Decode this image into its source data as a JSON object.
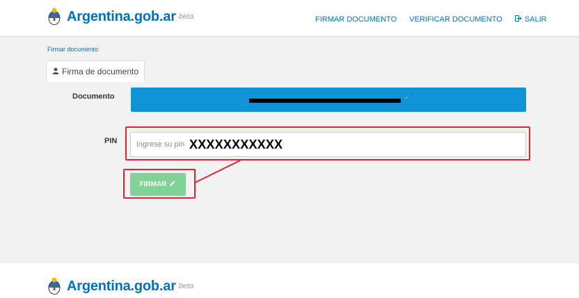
{
  "header": {
    "brand_name": "Argentina.gob.ar",
    "brand_tag": "beta",
    "nav": {
      "firmar": "FIRMAR DOCUMENTO",
      "verificar": "VERIFICAR DOCUMENTO",
      "salir": "SALIR"
    }
  },
  "main": {
    "breadcrumb": "Firmar documento",
    "tab_label": "Firma de documento",
    "documento_label": "Documento",
    "pin_label": "PIN",
    "pin_placeholder": "Ingrese su pin",
    "pin_value": "XXXXXXXXXXX",
    "firmar_button": "FIRMAR"
  },
  "footer": {
    "brand_name": "Argentina.gob.ar",
    "brand_tag": "beta"
  },
  "colors": {
    "brand_blue": "#0072bb",
    "doc_bar": "#0f94d8",
    "button_green": "#82d196",
    "highlight_red": "#e2232f"
  },
  "icons": [
    "argentina-emblem-icon",
    "exit-icon",
    "user-icon",
    "check-icon",
    "pencil-icon"
  ]
}
